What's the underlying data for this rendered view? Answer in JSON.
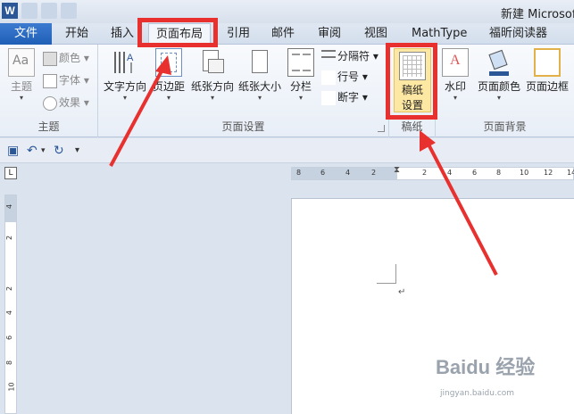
{
  "window": {
    "title": "新建 Microsoft"
  },
  "tabs": {
    "file": "文件",
    "items": [
      "开始",
      "插入",
      "页面布局",
      "引用",
      "邮件",
      "审阅",
      "视图",
      "MathType",
      "福昕阅读器"
    ],
    "active": "页面布局"
  },
  "ribbon": {
    "theme_group": {
      "label": "主题",
      "theme_button": "主题",
      "colors": "颜色",
      "fonts": "字体",
      "effects": "效果"
    },
    "page_setup_group": {
      "label": "页面设置",
      "text_direction": "文字方向",
      "margins": "页边距",
      "orientation": "纸张方向",
      "size": "纸张大小",
      "columns": "分栏",
      "breaks": "分隔符",
      "line_numbers": "行号",
      "hyphenation": "断字"
    },
    "manuscript_group": {
      "label": "稿纸",
      "setup_line1": "稿纸",
      "setup_line2": "设置"
    },
    "page_background_group": {
      "label": "页面背景",
      "watermark": "水印",
      "page_color": "页面颜色",
      "page_borders": "页面边框"
    }
  },
  "ruler": {
    "h_ticks": [
      "8",
      "6",
      "4",
      "2",
      "",
      "2",
      "4",
      "6",
      "8",
      "10",
      "12",
      "14"
    ],
    "v_ticks": [
      "4",
      "2",
      "",
      "2",
      "4",
      "6",
      "8",
      "10"
    ]
  },
  "watermark": {
    "brand": "Baidu 经验",
    "url": "jingyan.baidu.com"
  },
  "colors": {
    "accent": "#2b5797",
    "highlight": "#e8312f",
    "file_tab": "#2a6bc4"
  }
}
